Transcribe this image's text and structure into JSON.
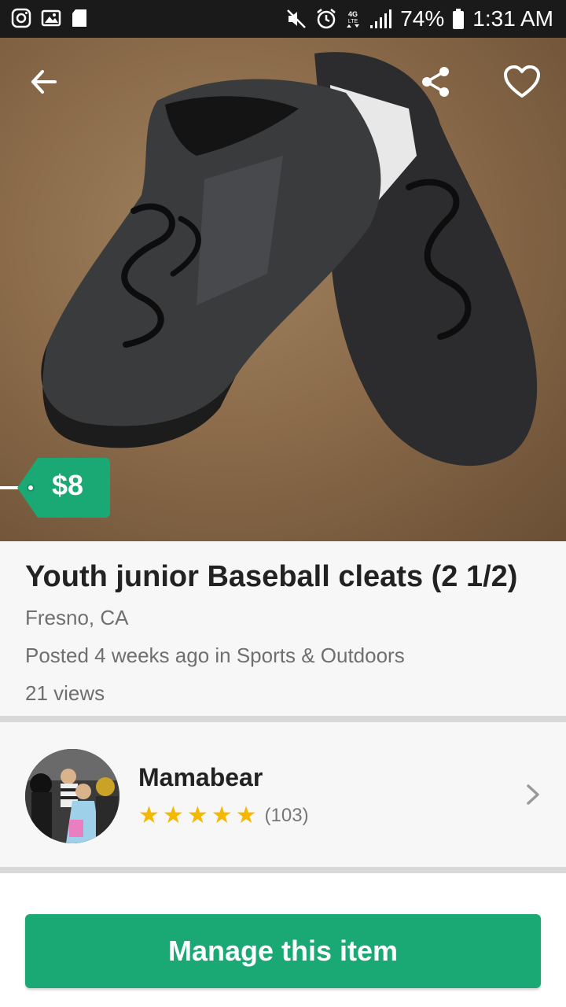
{
  "status_bar": {
    "battery": "74%",
    "time": "1:31 AM",
    "left_icons": [
      "instagram-icon",
      "gallery-icon",
      "sd-card-icon"
    ],
    "right_icons": [
      "mute-icon",
      "alarm-icon",
      "lte-icon",
      "signal-icon",
      "battery-icon"
    ]
  },
  "listing": {
    "price": "$8",
    "title": "Youth junior Baseball cleats (2 1/2)",
    "location": "Fresno, CA",
    "posted": "Posted 4 weeks ago in Sports & Outdoors",
    "views": "21 views"
  },
  "seller": {
    "name": "Mamabear",
    "rating_stars": 5,
    "rating_count": "(103)"
  },
  "actions": {
    "manage_label": "Manage this item"
  },
  "colors": {
    "accent": "#1aa874",
    "star": "#f5b800",
    "status_bar": "#1a1a1a"
  }
}
